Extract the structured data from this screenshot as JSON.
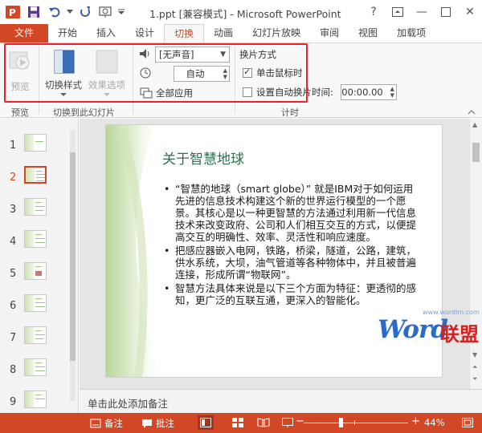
{
  "window": {
    "title": "1.ppt [兼容模式] - Microsoft PowerPoint",
    "help": "?",
    "minimize": "—",
    "close": "✕"
  },
  "tabs": [
    {
      "label": "文件"
    },
    {
      "label": "开始"
    },
    {
      "label": "插入"
    },
    {
      "label": "设计"
    },
    {
      "label": "切换"
    },
    {
      "label": "动画"
    },
    {
      "label": "幻灯片放映"
    },
    {
      "label": "审阅"
    },
    {
      "label": "视图"
    },
    {
      "label": "加载项"
    }
  ],
  "ribbon": {
    "preview_label": "预览",
    "transition_style_label": "切换样式",
    "effect_options_label": "效果选项",
    "sound_value": "[无声音]",
    "duration_value": "自动",
    "apply_all_label": "全部应用",
    "advance_title": "换片方式",
    "on_click_label": "单击鼠标时",
    "on_click_checked": true,
    "auto_after_label": "设置自动换片时间:",
    "auto_after_checked": false,
    "auto_after_value": "00:00.00",
    "group_preview": "预览",
    "group_transitions": "切换到此幻灯片",
    "group_timing": "计时",
    "highlight_color": "#e8232b"
  },
  "slides": {
    "numbers": [
      "1",
      "2",
      "3",
      "4",
      "5",
      "6",
      "7",
      "8",
      "9"
    ],
    "selected_index": 1
  },
  "slide": {
    "title": "关于智慧地球",
    "bullets": [
      "“智慧的地球（smart globe）” 就是IBM对于如何运用先进的信息技术构建这个新的世界运行模型的一个愿景。其核心是以一种更智慧的方法通过利用新一代信息技术来改变政府、公司和人们相互交互的方式，以便提高交互的明确性、效率、灵活性和响应速度。",
      "把感应器嵌入电网，铁路，桥梁，隧道，公路，建筑，供水系统，大坝，油气管道等各种物体中，并且被普遍连接，形成所谓“物联网”。",
      "智慧方法具体来说是以下三个方面为特征：更透彻的感知，更广泛的互联互通，更深入的智能化。"
    ]
  },
  "watermark": {
    "url": "www.wordlm.com",
    "word": "Word",
    "lm": "联盟"
  },
  "notes": {
    "placeholder": "单击此处添加备注"
  },
  "status": {
    "notes_label": "备注",
    "comments_label": "批注",
    "zoom_minus": "−",
    "zoom_plus": "+",
    "zoom_value": "44%",
    "zoom_level": 0.44
  },
  "colors": {
    "accent": "#d24726",
    "slide_title": "#2f6e4f"
  }
}
